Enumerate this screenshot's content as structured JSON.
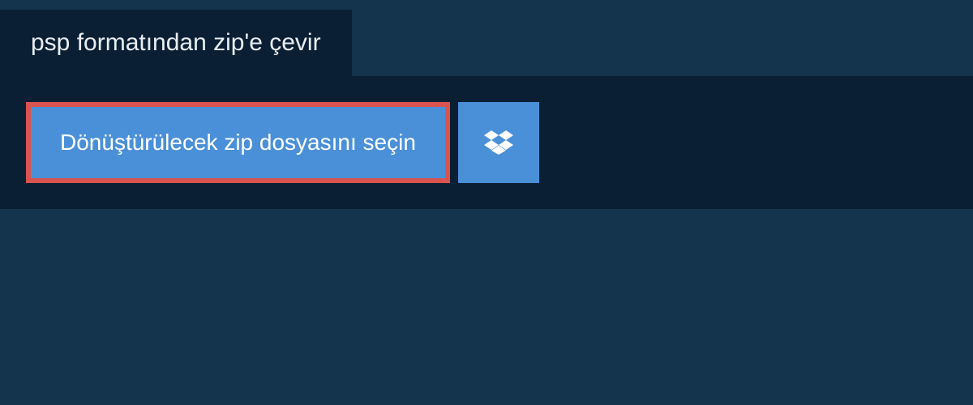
{
  "header": {
    "title": "psp formatından zip'e çevir"
  },
  "main": {
    "select_file_label": "Dönüştürülecek zip dosyasını seçin",
    "dropbox_icon_name": "dropbox-icon"
  },
  "colors": {
    "background_outer": "#14334d",
    "background_panel": "#0a1f33",
    "button_primary": "#4a90d9",
    "button_border_highlight": "#d9534f",
    "text_light": "#ffffff",
    "text_header": "#e8eef3"
  }
}
